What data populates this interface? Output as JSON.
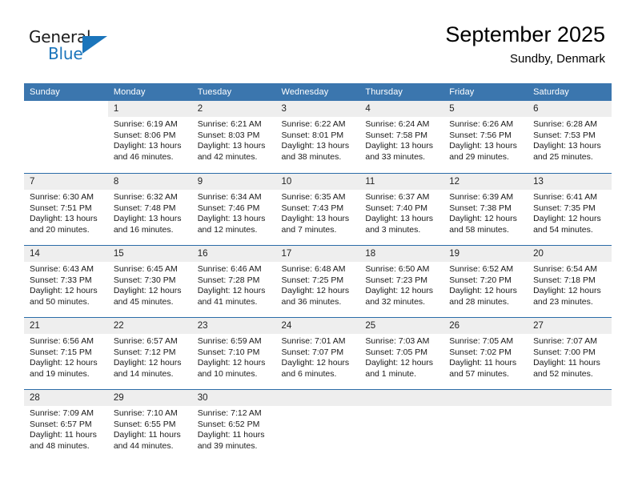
{
  "brand": {
    "name_part1": "General",
    "name_part2": "Blue",
    "accent_color": "#1b75bb"
  },
  "header": {
    "title": "September 2025",
    "subtitle": "Sundby, Denmark"
  },
  "theme": {
    "header_row_bg": "#3b76ae",
    "date_band_bg": "#eeeeee",
    "week_separator": "#2b6ca8"
  },
  "labels": {
    "sunrise_prefix": "Sunrise:",
    "sunset_prefix": "Sunset:",
    "daylight_prefix": "Daylight:"
  },
  "weekdays": [
    "Sunday",
    "Monday",
    "Tuesday",
    "Wednesday",
    "Thursday",
    "Friday",
    "Saturday"
  ],
  "weeks": [
    [
      {
        "date": "",
        "empty": true,
        "sunrise": "",
        "sunset": "",
        "daylight_line1": "",
        "daylight_line2": ""
      },
      {
        "date": "1",
        "sunrise": "Sunrise: 6:19 AM",
        "sunset": "Sunset: 8:06 PM",
        "daylight_line1": "Daylight: 13 hours",
        "daylight_line2": "and 46 minutes."
      },
      {
        "date": "2",
        "sunrise": "Sunrise: 6:21 AM",
        "sunset": "Sunset: 8:03 PM",
        "daylight_line1": "Daylight: 13 hours",
        "daylight_line2": "and 42 minutes."
      },
      {
        "date": "3",
        "sunrise": "Sunrise: 6:22 AM",
        "sunset": "Sunset: 8:01 PM",
        "daylight_line1": "Daylight: 13 hours",
        "daylight_line2": "and 38 minutes."
      },
      {
        "date": "4",
        "sunrise": "Sunrise: 6:24 AM",
        "sunset": "Sunset: 7:58 PM",
        "daylight_line1": "Daylight: 13 hours",
        "daylight_line2": "and 33 minutes."
      },
      {
        "date": "5",
        "sunrise": "Sunrise: 6:26 AM",
        "sunset": "Sunset: 7:56 PM",
        "daylight_line1": "Daylight: 13 hours",
        "daylight_line2": "and 29 minutes."
      },
      {
        "date": "6",
        "sunrise": "Sunrise: 6:28 AM",
        "sunset": "Sunset: 7:53 PM",
        "daylight_line1": "Daylight: 13 hours",
        "daylight_line2": "and 25 minutes."
      }
    ],
    [
      {
        "date": "7",
        "sunrise": "Sunrise: 6:30 AM",
        "sunset": "Sunset: 7:51 PM",
        "daylight_line1": "Daylight: 13 hours",
        "daylight_line2": "and 20 minutes."
      },
      {
        "date": "8",
        "sunrise": "Sunrise: 6:32 AM",
        "sunset": "Sunset: 7:48 PM",
        "daylight_line1": "Daylight: 13 hours",
        "daylight_line2": "and 16 minutes."
      },
      {
        "date": "9",
        "sunrise": "Sunrise: 6:34 AM",
        "sunset": "Sunset: 7:46 PM",
        "daylight_line1": "Daylight: 13 hours",
        "daylight_line2": "and 12 minutes."
      },
      {
        "date": "10",
        "sunrise": "Sunrise: 6:35 AM",
        "sunset": "Sunset: 7:43 PM",
        "daylight_line1": "Daylight: 13 hours",
        "daylight_line2": "and 7 minutes."
      },
      {
        "date": "11",
        "sunrise": "Sunrise: 6:37 AM",
        "sunset": "Sunset: 7:40 PM",
        "daylight_line1": "Daylight: 13 hours",
        "daylight_line2": "and 3 minutes."
      },
      {
        "date": "12",
        "sunrise": "Sunrise: 6:39 AM",
        "sunset": "Sunset: 7:38 PM",
        "daylight_line1": "Daylight: 12 hours",
        "daylight_line2": "and 58 minutes."
      },
      {
        "date": "13",
        "sunrise": "Sunrise: 6:41 AM",
        "sunset": "Sunset: 7:35 PM",
        "daylight_line1": "Daylight: 12 hours",
        "daylight_line2": "and 54 minutes."
      }
    ],
    [
      {
        "date": "14",
        "sunrise": "Sunrise: 6:43 AM",
        "sunset": "Sunset: 7:33 PM",
        "daylight_line1": "Daylight: 12 hours",
        "daylight_line2": "and 50 minutes."
      },
      {
        "date": "15",
        "sunrise": "Sunrise: 6:45 AM",
        "sunset": "Sunset: 7:30 PM",
        "daylight_line1": "Daylight: 12 hours",
        "daylight_line2": "and 45 minutes."
      },
      {
        "date": "16",
        "sunrise": "Sunrise: 6:46 AM",
        "sunset": "Sunset: 7:28 PM",
        "daylight_line1": "Daylight: 12 hours",
        "daylight_line2": "and 41 minutes."
      },
      {
        "date": "17",
        "sunrise": "Sunrise: 6:48 AM",
        "sunset": "Sunset: 7:25 PM",
        "daylight_line1": "Daylight: 12 hours",
        "daylight_line2": "and 36 minutes."
      },
      {
        "date": "18",
        "sunrise": "Sunrise: 6:50 AM",
        "sunset": "Sunset: 7:23 PM",
        "daylight_line1": "Daylight: 12 hours",
        "daylight_line2": "and 32 minutes."
      },
      {
        "date": "19",
        "sunrise": "Sunrise: 6:52 AM",
        "sunset": "Sunset: 7:20 PM",
        "daylight_line1": "Daylight: 12 hours",
        "daylight_line2": "and 28 minutes."
      },
      {
        "date": "20",
        "sunrise": "Sunrise: 6:54 AM",
        "sunset": "Sunset: 7:18 PM",
        "daylight_line1": "Daylight: 12 hours",
        "daylight_line2": "and 23 minutes."
      }
    ],
    [
      {
        "date": "21",
        "sunrise": "Sunrise: 6:56 AM",
        "sunset": "Sunset: 7:15 PM",
        "daylight_line1": "Daylight: 12 hours",
        "daylight_line2": "and 19 minutes."
      },
      {
        "date": "22",
        "sunrise": "Sunrise: 6:57 AM",
        "sunset": "Sunset: 7:12 PM",
        "daylight_line1": "Daylight: 12 hours",
        "daylight_line2": "and 14 minutes."
      },
      {
        "date": "23",
        "sunrise": "Sunrise: 6:59 AM",
        "sunset": "Sunset: 7:10 PM",
        "daylight_line1": "Daylight: 12 hours",
        "daylight_line2": "and 10 minutes."
      },
      {
        "date": "24",
        "sunrise": "Sunrise: 7:01 AM",
        "sunset": "Sunset: 7:07 PM",
        "daylight_line1": "Daylight: 12 hours",
        "daylight_line2": "and 6 minutes."
      },
      {
        "date": "25",
        "sunrise": "Sunrise: 7:03 AM",
        "sunset": "Sunset: 7:05 PM",
        "daylight_line1": "Daylight: 12 hours",
        "daylight_line2": "and 1 minute."
      },
      {
        "date": "26",
        "sunrise": "Sunrise: 7:05 AM",
        "sunset": "Sunset: 7:02 PM",
        "daylight_line1": "Daylight: 11 hours",
        "daylight_line2": "and 57 minutes."
      },
      {
        "date": "27",
        "sunrise": "Sunrise: 7:07 AM",
        "sunset": "Sunset: 7:00 PM",
        "daylight_line1": "Daylight: 11 hours",
        "daylight_line2": "and 52 minutes."
      }
    ],
    [
      {
        "date": "28",
        "sunrise": "Sunrise: 7:09 AM",
        "sunset": "Sunset: 6:57 PM",
        "daylight_line1": "Daylight: 11 hours",
        "daylight_line2": "and 48 minutes."
      },
      {
        "date": "29",
        "sunrise": "Sunrise: 7:10 AM",
        "sunset": "Sunset: 6:55 PM",
        "daylight_line1": "Daylight: 11 hours",
        "daylight_line2": "and 44 minutes."
      },
      {
        "date": "30",
        "sunrise": "Sunrise: 7:12 AM",
        "sunset": "Sunset: 6:52 PM",
        "daylight_line1": "Daylight: 11 hours",
        "daylight_line2": "and 39 minutes."
      },
      {
        "date": "",
        "blank_band": true,
        "sunrise": "",
        "sunset": "",
        "daylight_line1": "",
        "daylight_line2": ""
      },
      {
        "date": "",
        "blank_band": true,
        "sunrise": "",
        "sunset": "",
        "daylight_line1": "",
        "daylight_line2": ""
      },
      {
        "date": "",
        "blank_band": true,
        "sunrise": "",
        "sunset": "",
        "daylight_line1": "",
        "daylight_line2": ""
      },
      {
        "date": "",
        "blank_band": true,
        "sunrise": "",
        "sunset": "",
        "daylight_line1": "",
        "daylight_line2": ""
      }
    ]
  ]
}
